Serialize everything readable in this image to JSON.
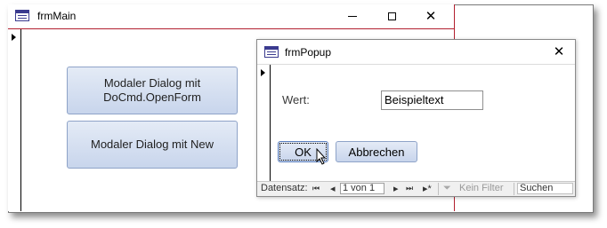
{
  "main_window": {
    "title": "frmMain",
    "buttons": {
      "opendialog_label": "Modaler Dialog mit\nDoCmd.OpenForm",
      "new_label": "Modaler Dialog mit New"
    }
  },
  "popup": {
    "title": "frmPopup",
    "field_label": "Wert:",
    "field_value": "Beispieltext",
    "ok_label": "OK",
    "cancel_label": "Abbrechen",
    "navigation": {
      "label": "Datensatz:",
      "first": "⏮",
      "prev": "◂",
      "record_text": "1 von 1",
      "next": "▸",
      "last": "⏭",
      "new": "▸*",
      "filter_label": "Kein Filter",
      "search_text": "Suchen"
    }
  },
  "colors": {
    "accent": "#b2202f",
    "button_top": "#e4ebf6",
    "button_bottom": "#c8d5ec"
  }
}
